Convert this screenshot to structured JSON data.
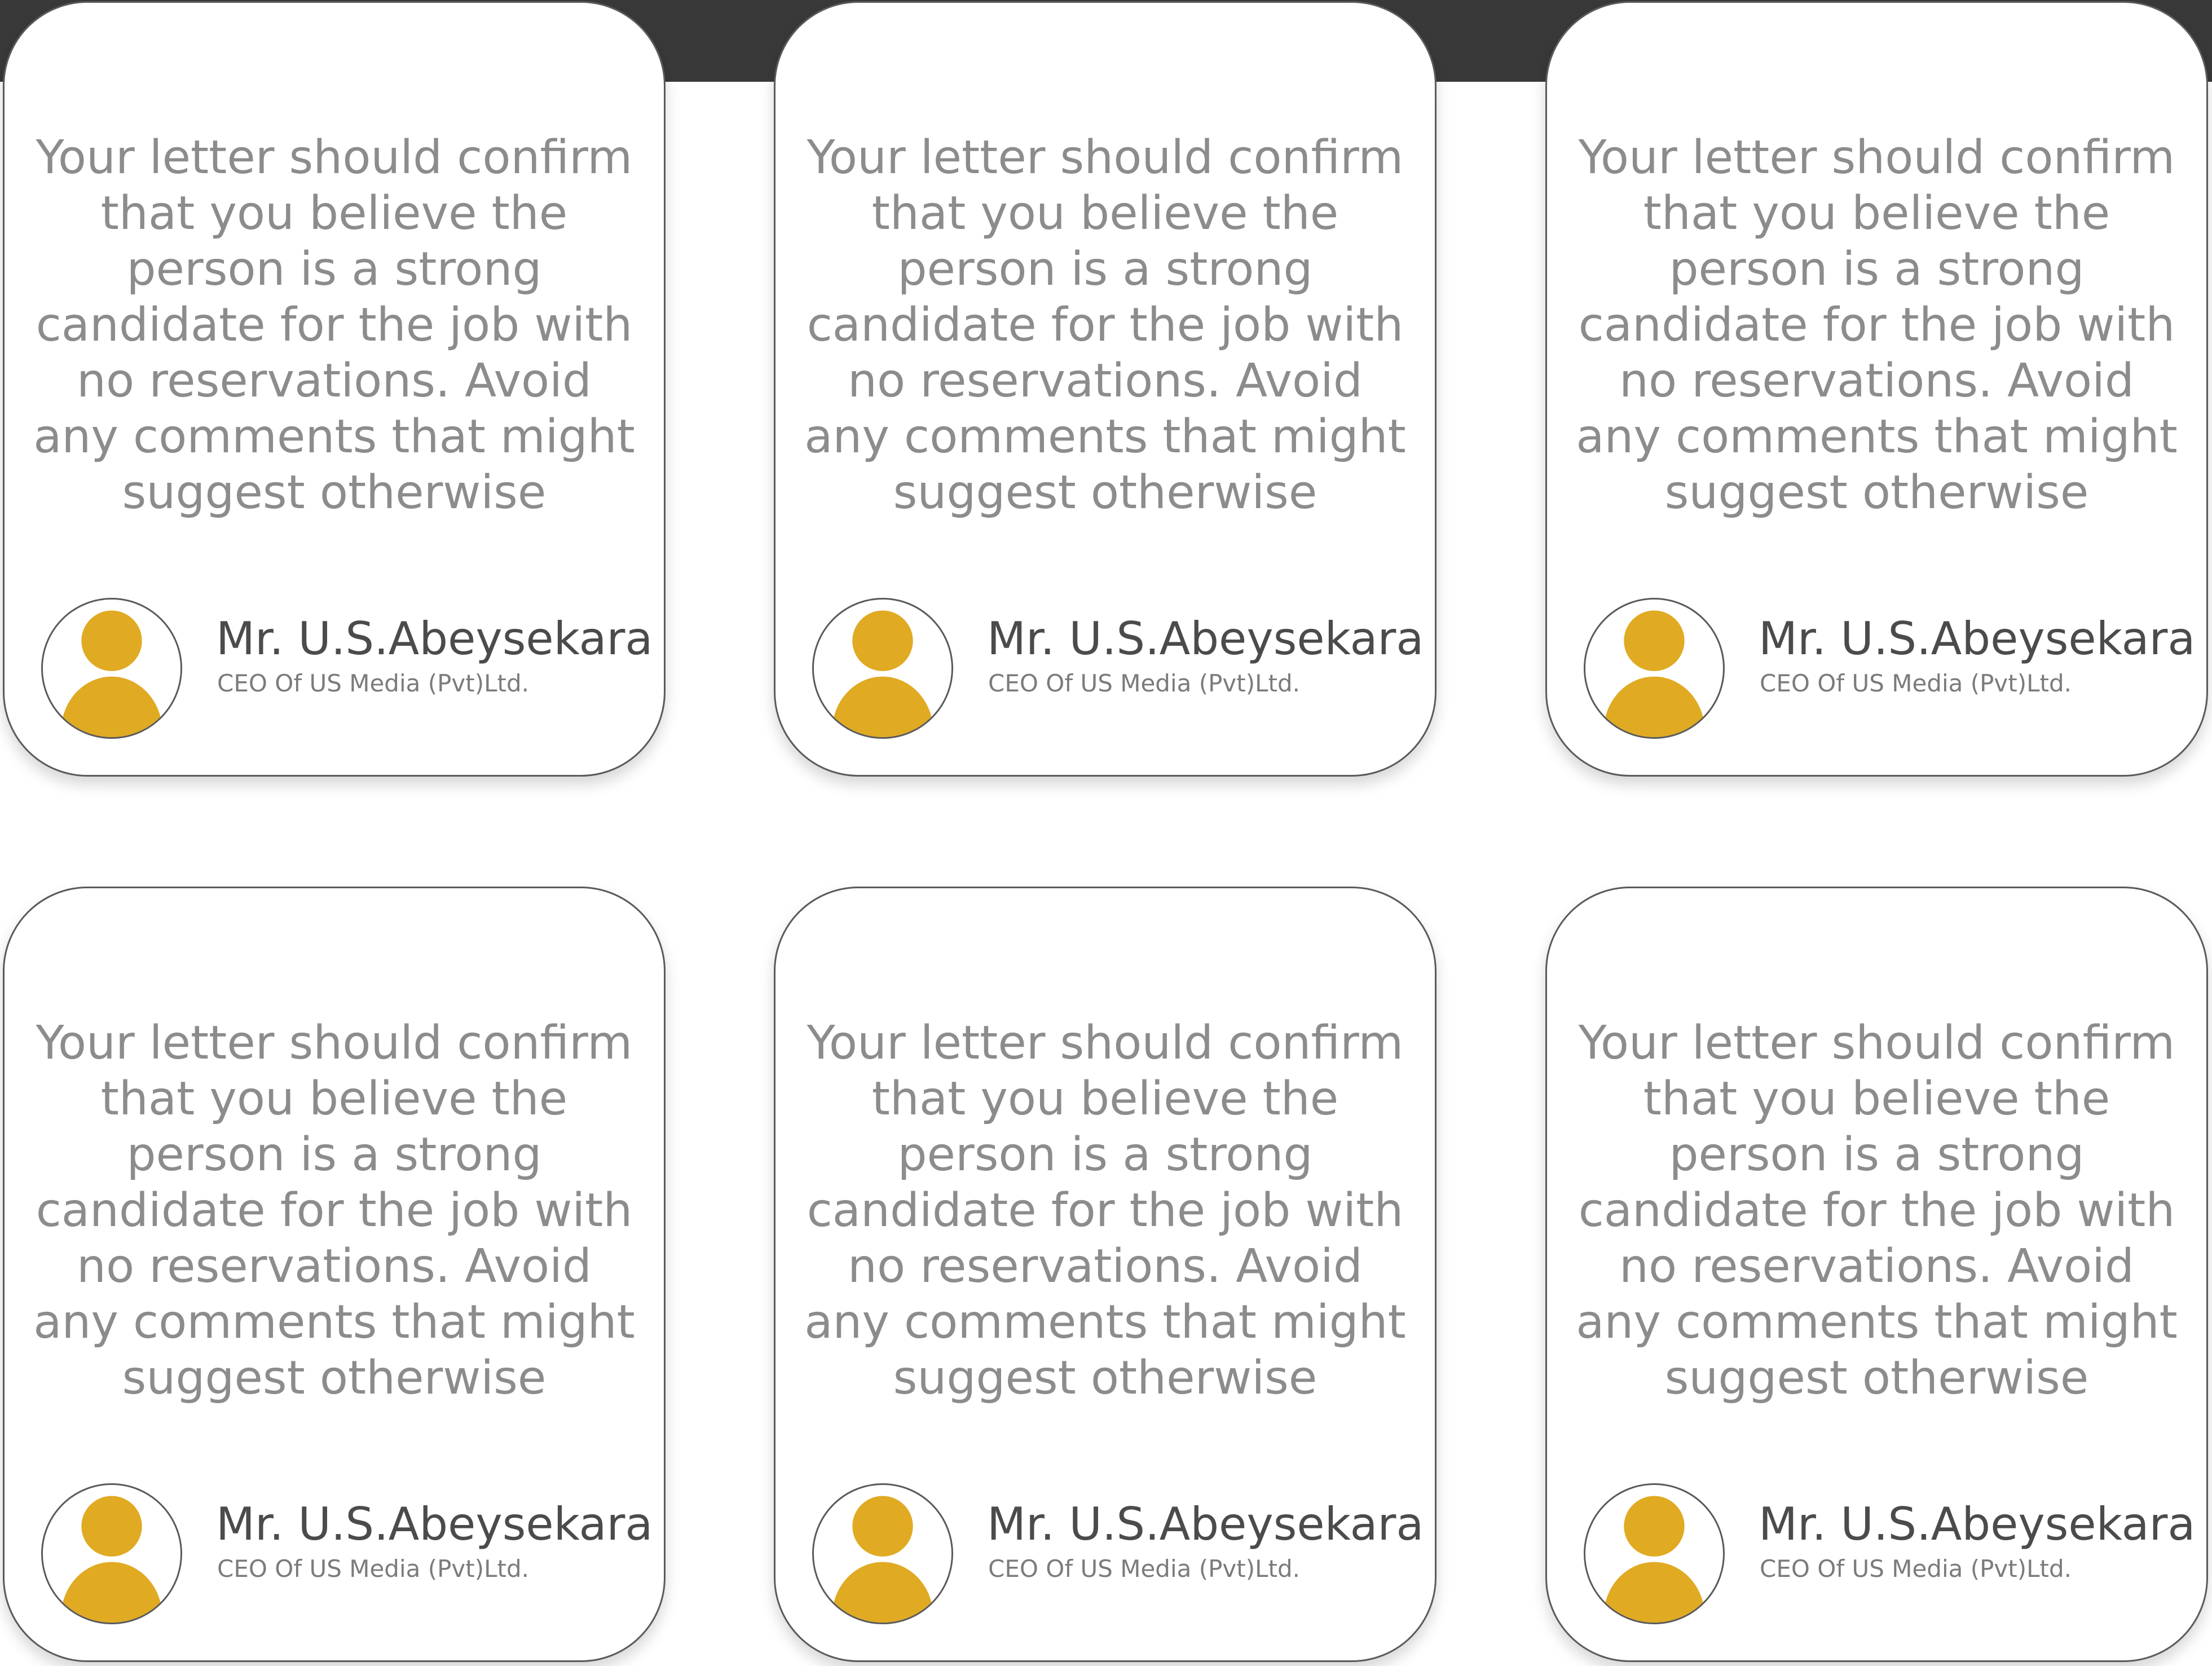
{
  "colors": {
    "top_band": "#3a3939",
    "card_border": "#5a5a5a",
    "quote_text": "#8c8c8c",
    "name_text": "#4b4b4b",
    "avatar_accent": "#e0aa22"
  },
  "cards": [
    {
      "quote": "Your letter should confirm that you believe the person is a strong candidate for the job with no reservations. Avoid any comments that might suggest otherwise",
      "name": "Mr. U.S.Abeysekara",
      "title": "CEO Of US Media (Pvt)Ltd.",
      "avatar_icon": "user-avatar-icon"
    },
    {
      "quote": "Your letter should confirm that you believe the person is a strong candidate for the job with no reservations. Avoid any comments that might suggest otherwise",
      "name": "Mr. U.S.Abeysekara",
      "title": "CEO Of US Media (Pvt)Ltd.",
      "avatar_icon": "user-avatar-icon"
    },
    {
      "quote": "Your letter should confirm that you believe the person is a strong candidate for the job with no reservations. Avoid any comments that might suggest otherwise",
      "name": "Mr. U.S.Abeysekara",
      "title": "CEO Of US Media (Pvt)Ltd.",
      "avatar_icon": "user-avatar-icon"
    },
    {
      "quote": "Your letter should confirm that you believe the person is a strong candidate for the job with no reservations. Avoid any comments that might suggest otherwise",
      "name": "Mr. U.S.Abeysekara",
      "title": "CEO Of US Media (Pvt)Ltd.",
      "avatar_icon": "user-avatar-icon"
    },
    {
      "quote": "Your letter should confirm that you believe the person is a strong candidate for the job with no reservations. Avoid any comments that might suggest otherwise",
      "name": "Mr. U.S.Abeysekara",
      "title": "CEO Of US Media (Pvt)Ltd.",
      "avatar_icon": "user-avatar-icon"
    },
    {
      "quote": "Your letter should confirm that you believe the person is a strong candidate for the job with no reservations. Avoid any comments that might suggest otherwise",
      "name": "Mr. U.S.Abeysekara",
      "title": "CEO Of US Media (Pvt)Ltd.",
      "avatar_icon": "user-avatar-icon"
    }
  ]
}
